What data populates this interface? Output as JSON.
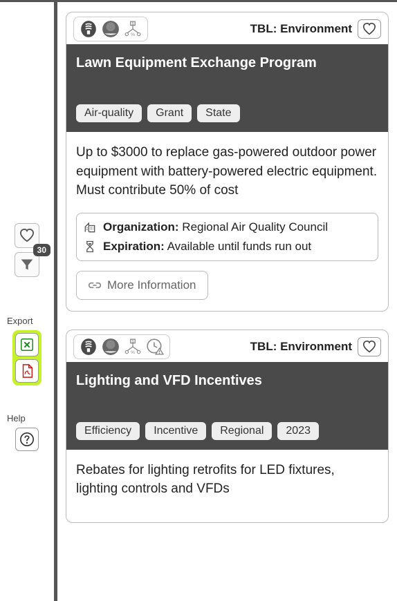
{
  "sidebar": {
    "filter_count": "30",
    "export_label": "Export",
    "help_label": "Help"
  },
  "cards": [
    {
      "tbl": "TBL: Environment",
      "title": "Lawn Equipment Exchange Program",
      "tags": [
        "Air-quality",
        "Grant",
        "State"
      ],
      "description": "Up to $3000 to replace gas-powered outdoor power equipment with battery-powered electric equipment. Must contribute 50% of cost",
      "org_label": "Organization:",
      "org_value": "Regional Air Quality Council",
      "exp_label": "Expiration:",
      "exp_value": "Available until funds run out",
      "more_label": "More Information",
      "has_extra_icon": false
    },
    {
      "tbl": "TBL: Environment",
      "title": "Lighting and VFD Incentives",
      "tags": [
        "Efficiency",
        "Incentive",
        "Regional",
        "2023"
      ],
      "description": "Rebates for lighting retrofits for LED fixtures, lighting controls and VFDs",
      "has_extra_icon": true
    }
  ]
}
